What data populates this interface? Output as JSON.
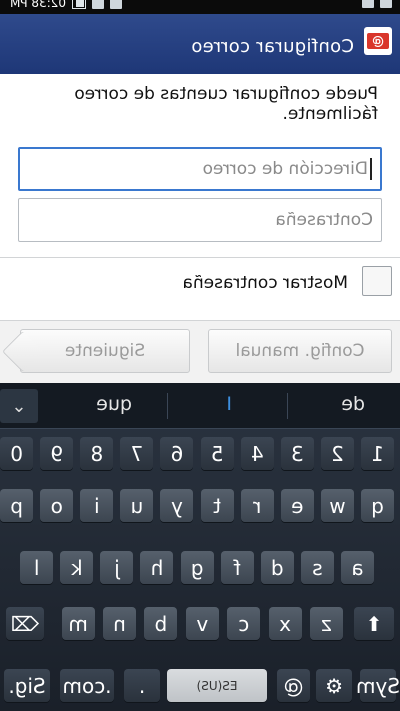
{
  "status_bar": {
    "time": "02:38 PM"
  },
  "header": {
    "title": "Configurar correo",
    "icon": "email-app-icon",
    "brand_color": "#23397c"
  },
  "main": {
    "description": "Puede configurar cuentas de correo fácilmente.",
    "email": {
      "placeholder": "Dirección de correo",
      "value": ""
    },
    "password": {
      "placeholder": "Contraseña",
      "value": ""
    },
    "show_password_label": "Mostrar contraseña",
    "manual_button": "Config. manual",
    "next_button": "Siguiente"
  },
  "keyboard": {
    "suggestions": [
      "de",
      "I",
      "que"
    ],
    "collapse_label": "⌄",
    "row_numbers": [
      "1",
      "2",
      "3",
      "4",
      "5",
      "6",
      "7",
      "8",
      "9",
      "0"
    ],
    "row_top": [
      "q",
      "w",
      "e",
      "r",
      "t",
      "y",
      "u",
      "i",
      "o",
      "p"
    ],
    "row_mid": [
      "a",
      "s",
      "d",
      "f",
      "g",
      "h",
      "j",
      "k",
      "l"
    ],
    "row_bottom": [
      "z",
      "x",
      "c",
      "v",
      "b",
      "n",
      "m"
    ],
    "shift_label": "⬆",
    "delete_label": "⌫",
    "sym_label": "Sym",
    "settings_label": "⚙",
    "at_label": "@",
    "space_label": "ES(US)",
    "dot_label": ".",
    "com_label": ".com",
    "sig_label": "Sig."
  }
}
